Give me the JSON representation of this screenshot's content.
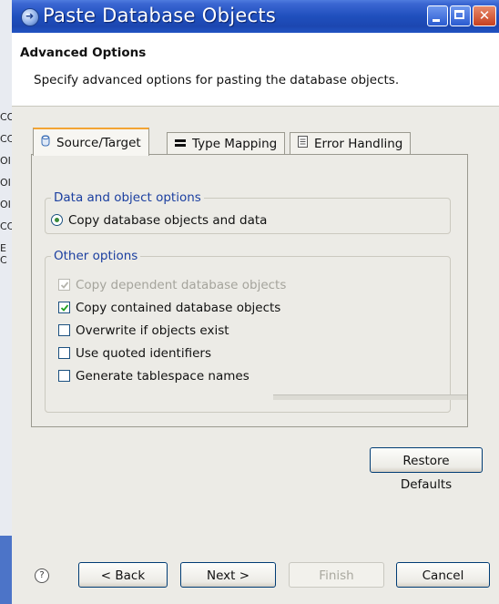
{
  "window": {
    "title": "Paste Database Objects"
  },
  "background_window": {
    "fragments": [
      "CO",
      "CC",
      "OI",
      "OI",
      "OI",
      "CC",
      "E C"
    ]
  },
  "header": {
    "title": "Advanced Options",
    "description": "Specify advanced options for pasting the database objects."
  },
  "tabs": [
    {
      "label": "Source/Target",
      "icon": "database-icon",
      "selected": true
    },
    {
      "label": "Type Mapping",
      "icon": "mapping-icon",
      "selected": false
    },
    {
      "label": "Error Handling",
      "icon": "document-icon",
      "selected": false
    }
  ],
  "data_options": {
    "legend": "Data and object options",
    "radio_label": "Copy database objects and data",
    "radio_selected": true
  },
  "other_options": {
    "legend": "Other options",
    "items": [
      {
        "label": "Copy dependent database objects",
        "checked": true,
        "enabled": false
      },
      {
        "label": "Copy contained database objects",
        "checked": true,
        "enabled": true
      },
      {
        "label": "Overwrite if objects exist",
        "checked": false,
        "enabled": true
      },
      {
        "label": "Use quoted identifiers",
        "checked": false,
        "enabled": true
      },
      {
        "label": "Generate tablespace names",
        "checked": false,
        "enabled": true
      }
    ]
  },
  "buttons": {
    "restore": "Restore Defaults",
    "back": "< Back",
    "next": "Next >",
    "finish": "Finish",
    "cancel": "Cancel",
    "help": "?"
  },
  "colors": {
    "titlebar": "#1f4fbd",
    "legend": "#1b3fa0",
    "tab_highlight": "#f3a433",
    "dialog_bg": "#ecebe6"
  }
}
